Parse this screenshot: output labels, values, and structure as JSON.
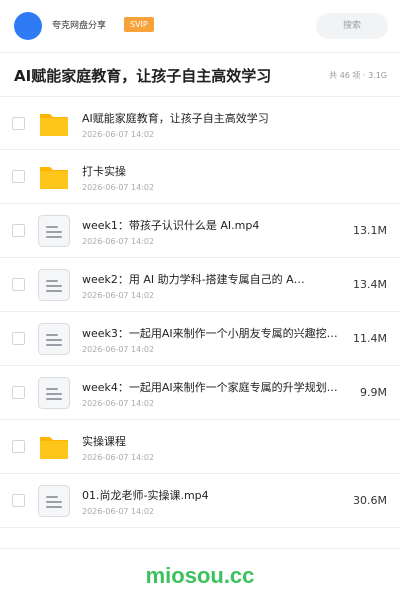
{
  "header": {
    "share_name": "夸克网盘分享",
    "badge": "SVIP",
    "search_placeholder": "搜索"
  },
  "page": {
    "title": "AI赋能家庭教育，让孩子自主高效学习",
    "summary": "共 46 项 · 3.1G"
  },
  "files": [
    {
      "type": "folder",
      "name": "AI赋能家庭教育，让孩子自主高效学习",
      "date": "2026-06-07 14:02",
      "size": ""
    },
    {
      "type": "folder",
      "name": "打卡实操",
      "date": "2026-06-07 14:02",
      "size": ""
    },
    {
      "type": "file",
      "name": "week1：带孩子认识什么是 AI.mp4",
      "date": "2026-06-07 14:02",
      "size": "13.1M"
    },
    {
      "type": "file",
      "name": "week2：用 AI 助力学科-搭建专属自己的 A…",
      "date": "2026-06-07 14:02",
      "size": "13.4M"
    },
    {
      "type": "file",
      "name": "week3：一起用AI来制作一个小朋友专属的兴趣挖…",
      "date": "2026-06-07 14:02",
      "size": "11.4M"
    },
    {
      "type": "file",
      "name": "week4：一起用AI来制作一个家庭专属的升学规划…",
      "date": "2026-06-07 14:02",
      "size": "9.9M"
    },
    {
      "type": "folder",
      "name": "实操课程",
      "date": "2026-06-07 14:02",
      "size": ""
    },
    {
      "type": "file",
      "name": "01.尚龙老师-实操课.mp4",
      "date": "2026-06-07 14:02",
      "size": "30.6M"
    }
  ],
  "icons": {
    "folder": "folder-icon",
    "file": "document-icon"
  },
  "colors": {
    "avatar": "#2f7bf5",
    "badge": "#f7a23b",
    "folder": "#ffc61a",
    "watermark": "#3cc25c"
  },
  "watermark": "miosou.cc"
}
